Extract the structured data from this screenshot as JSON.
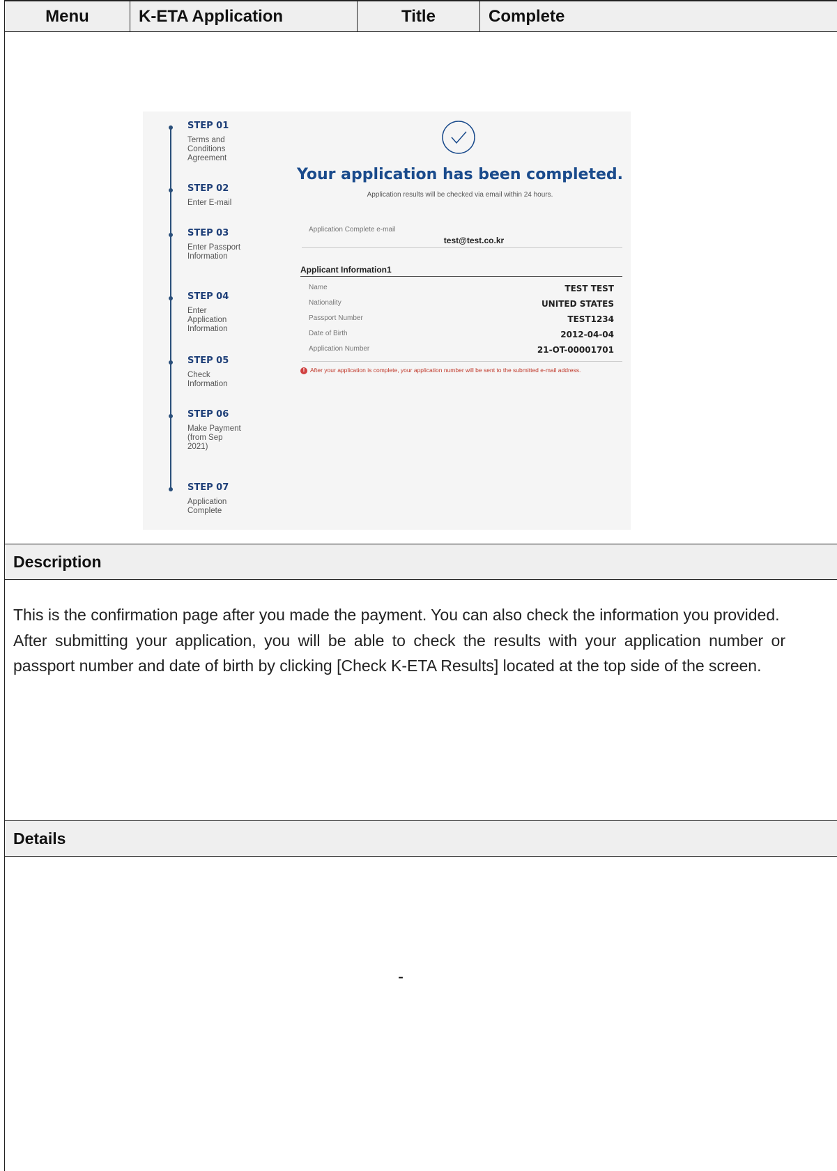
{
  "header": {
    "menu_label": "Menu",
    "menu_value": "K-ETA Application",
    "title_label": "Title",
    "title_value": "Complete"
  },
  "screenshot": {
    "steps": [
      {
        "name": "STEP 01",
        "desc": "Terms and Conditions Agreement"
      },
      {
        "name": "STEP 02",
        "desc": "Enter E-mail"
      },
      {
        "name": "STEP 03",
        "desc": "Enter Passport Information"
      },
      {
        "name": "STEP 04",
        "desc": "Enter Application Information"
      },
      {
        "name": "STEP 05",
        "desc": "Check Information"
      },
      {
        "name": "STEP 06",
        "desc": "Make Payment (from Sep 2021)"
      },
      {
        "name": "STEP 07",
        "desc": "Application Complete"
      }
    ],
    "heading": "Your application has been completed.",
    "subheading": "Application results will be checked via email within 24 hours.",
    "email_label": "Application Complete e-mail",
    "email_value": "test@test.co.kr",
    "applicant_heading": "Applicant Information1",
    "fields": [
      {
        "label": "Name",
        "value": "TEST TEST"
      },
      {
        "label": "Nationality",
        "value": "UNITED STATES"
      },
      {
        "label": "Passport Number",
        "value": "TEST1234"
      },
      {
        "label": "Date of Birth",
        "value": "2012-04-04"
      },
      {
        "label": "Application Number",
        "value": "21-OT-00001701"
      }
    ],
    "notice": "After your application is complete, your application number will be sent to the submitted e-mail address.",
    "accent_color": "#1a4b8c",
    "notice_color": "#c0392b"
  },
  "description": {
    "label": "Description",
    "paragraph1": "This is the confirmation page after you made the payment. You can also check the information you provided.",
    "paragraph2": "After submitting your application, you will be able to check the results with your application number or passport number and date of birth by clicking [Check K-ETA Results] located at the top side of the screen."
  },
  "details": {
    "label": "Details",
    "value": "-"
  }
}
